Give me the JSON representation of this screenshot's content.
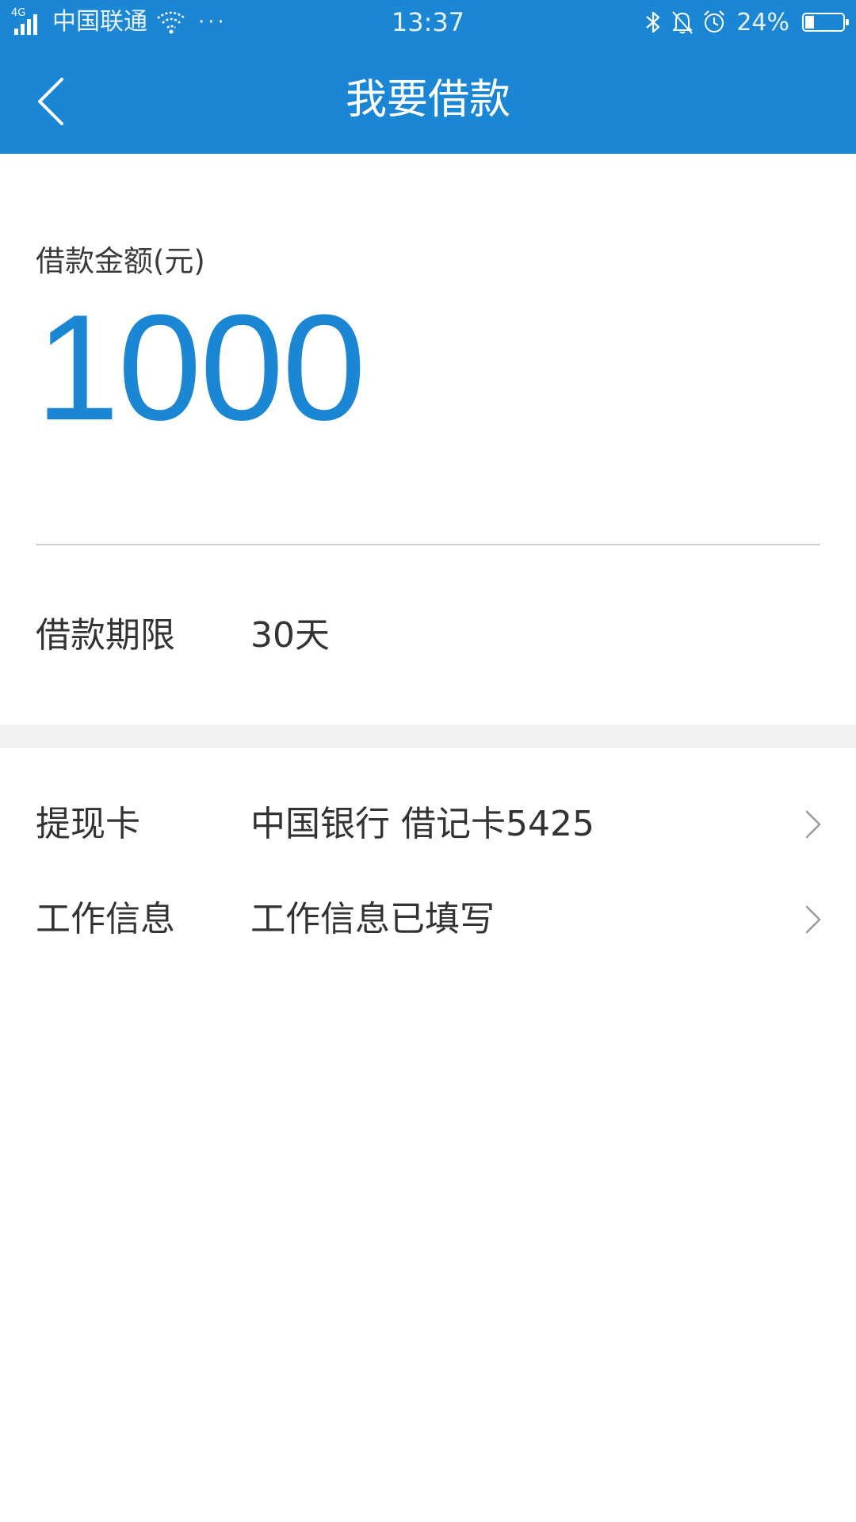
{
  "status_bar": {
    "network_label": "4G",
    "carrier": "中国联通",
    "more": "···",
    "time": "13:37",
    "battery_percent": "24%",
    "battery_level": 0.24,
    "icons": [
      "signal-icon",
      "wifi-icon",
      "bluetooth-icon",
      "mute-bell-icon",
      "alarm-icon",
      "battery-icon"
    ]
  },
  "header": {
    "title": "我要借款",
    "background_color": "#1b86d3"
  },
  "amount": {
    "label": "借款金额(元)",
    "value": "1000",
    "accent_color": "#1b86d3"
  },
  "term": {
    "label": "借款期限",
    "value": "30天"
  },
  "rows": [
    {
      "label": "提现卡",
      "value": "中国银行 借记卡5425"
    },
    {
      "label": "工作信息",
      "value": "工作信息已填写"
    }
  ]
}
